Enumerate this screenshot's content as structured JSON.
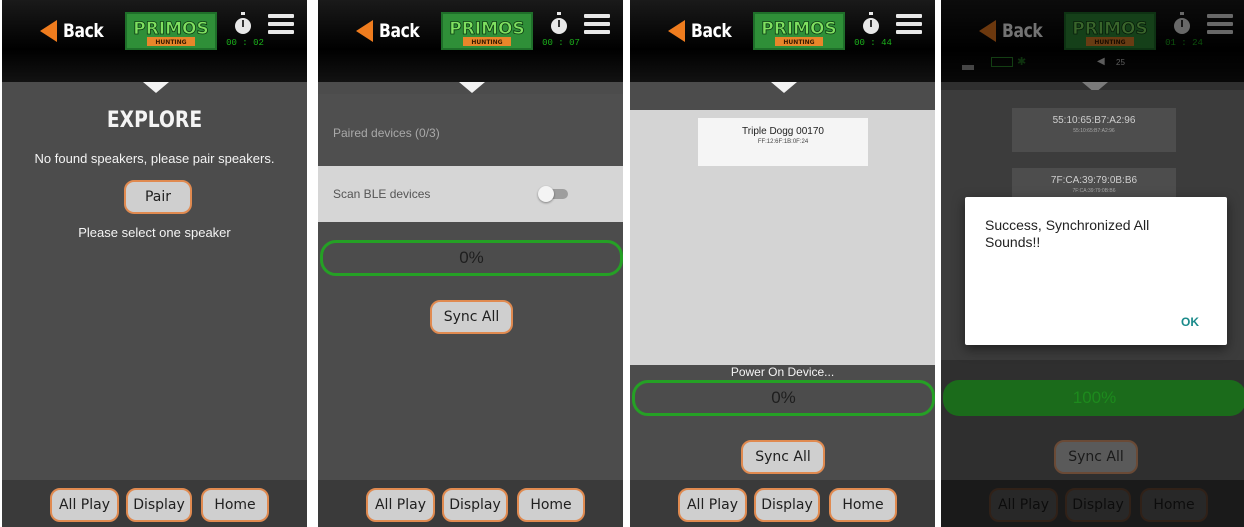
{
  "header": {
    "back_label": "Back",
    "logo_text": "PRIMOS",
    "logo_sub": "HUNTING",
    "colors": {
      "accent": "#ef7c1e",
      "timer": "#1bb01b",
      "progress": "#25a025",
      "dialog_ok": "#1a8a8a"
    }
  },
  "nav": {
    "all_play": "All Play",
    "display": "Display",
    "home": "Home"
  },
  "screen1": {
    "timer": "00 : 02",
    "title": "EXPLORE",
    "message": "No found speakers, please pair speakers.",
    "pair_label": "Pair",
    "select_message": "Please select one speaker"
  },
  "screen2": {
    "timer": "00 : 07",
    "paired_label": "Paired devices (0/3)",
    "scan_label": "Scan BLE devices",
    "scan_enabled": false,
    "progress": "0%",
    "sync_label": "Sync All"
  },
  "screen3": {
    "timer": "00 : 44",
    "device_name": "Triple Dogg  00170",
    "device_mac": "FF:12:6F:1B:0F:24",
    "status": "Power On Device...",
    "progress": "0%",
    "sync_label": "Sync All"
  },
  "screen4": {
    "timer": "01 : 24",
    "volume": "25",
    "devices": [
      {
        "mac": "55:10:65:B7:A2:96",
        "sub": "55:10:65:B7:A2:96"
      },
      {
        "mac": "7F:CA:39:79:0B:B6",
        "sub": "7F:CA:39:79:0B:B6"
      }
    ],
    "progress": "100%",
    "sync_label": "Sync All",
    "dialog_message": "Success, Synchronized All Sounds!!",
    "dialog_ok": "OK"
  }
}
